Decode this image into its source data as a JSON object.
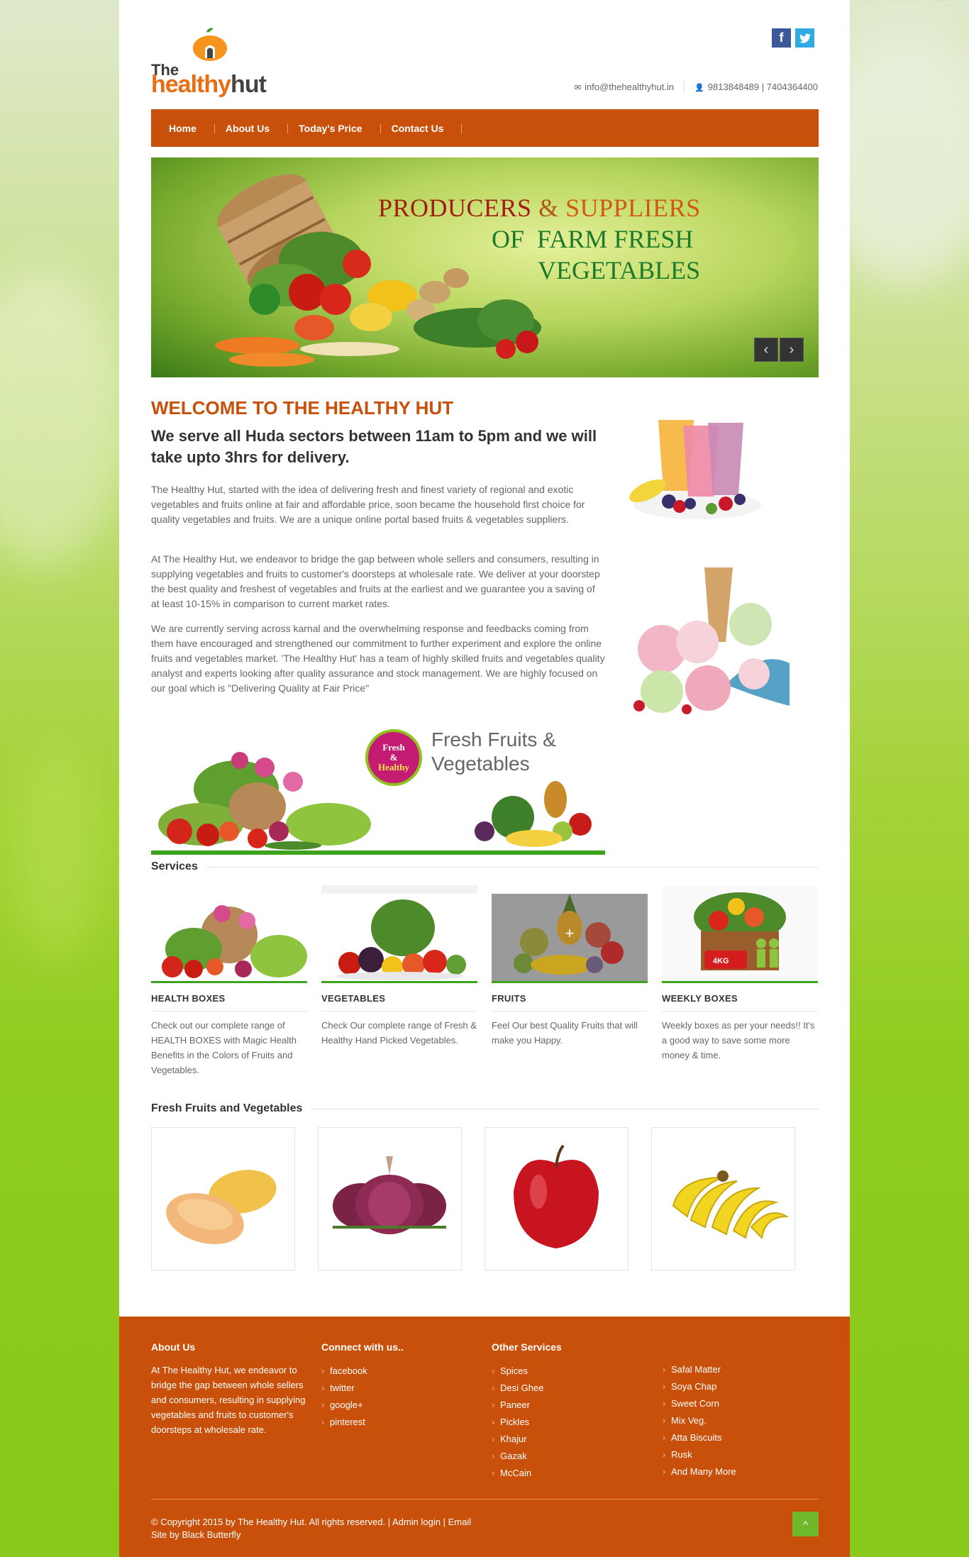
{
  "header": {
    "logo_the": "The",
    "logo_healthy": "healthy",
    "logo_hut": "hut",
    "email": "info@thehealthyhut.in",
    "phone": "9813848489 | 7404364400"
  },
  "social": {
    "facebook": "f",
    "twitter": "t"
  },
  "nav": {
    "items": [
      {
        "label": "Home"
      },
      {
        "label": "About Us"
      },
      {
        "label": "Today's Price"
      },
      {
        "label": "Contact Us"
      }
    ]
  },
  "slider": {
    "line1_a": "PRODUCERS",
    "line1_amp": "&",
    "line1_b": "SUPPLIERS",
    "line2": "OF  FARM FRESH",
    "line3": "VEGETABLES",
    "prev": "‹",
    "next": "›"
  },
  "welcome": {
    "title": "WELCOME TO THE HEALTHY HUT",
    "subtitle": "We serve all Huda sectors between 11am to 5pm and we will take upto 3hrs for delivery.",
    "p1": "The Healthy Hut, started with the idea of delivering fresh and finest variety of regional and exotic vegetables and fruits online at fair and affordable price, soon became the household first choice for quality vegetables and fruits. We are a unique online portal based fruits & vegetables suppliers.",
    "p2": "At The Healthy Hut, we endeavor to bridge the gap between whole sellers and consumers, resulting in supplying vegetables and fruits to customer's doorsteps at wholesale rate. We deliver at your doorstep the best quality and freshest of vegetables and fruits at the earliest and we guarantee you a saving of at least 10-15% in comparison to current market rates.",
    "p3": "We are currently serving across karnal and the overwhelming response and feedbacks coming from them have encouraged and strengthened our commitment to further experiment and explore the online fruits and vegetables market. 'The Healthy Hut' has a team of highly skilled fruits and vegetables quality analyst and experts looking after quality assurance and stock management. We are highly focused on our goal which is \"Delivering Quality at Fair Price\""
  },
  "banner": {
    "badge_l1": "Fresh",
    "badge_l2": "&",
    "badge_l3": "Healthy",
    "line1": "Fresh Fruits &",
    "line2": "Vegetables"
  },
  "services": {
    "heading": "Services",
    "items": [
      {
        "title": "HEALTH BOXES",
        "text": "Check out our complete range of HEALTH BOXES with Magic Health Benefits in the Colors of Fruits and Vegetables."
      },
      {
        "title": "VEGETABLES",
        "text": "Check Our complete range of Fresh & Healthy Hand Picked Vegetables."
      },
      {
        "title": "FRUITS",
        "text": "Feel Our best Quality Fruits that will make you Happy."
      },
      {
        "title": "WEEKLY BOXES",
        "text": "Weekly boxes as per your needs!! It's a good way to save some more money & time."
      }
    ],
    "plus": "+",
    "box_label": "4KG"
  },
  "products": {
    "heading": "Fresh Fruits and Vegetables"
  },
  "footer": {
    "about_title": "About Us",
    "about_text": "At The Healthy Hut, we endeavor to bridge the gap between whole sellers and consumers, resulting in supplying vegetables and fruits to customer's doorsteps at wholesale rate.",
    "connect_title": "Connect with us..",
    "connect": [
      "facebook",
      "twitter",
      "google+",
      "pinterest"
    ],
    "services_title": "Other Services",
    "services_a": [
      "Spices",
      "Desi Ghee",
      "Paneer",
      "Pickles",
      "Khajur",
      "Gazak",
      "McCain"
    ],
    "services_b": [
      "Safal Matter",
      "Soya Chap",
      "Sweet Corn",
      "Mix Veg.",
      "Atta Biscuits",
      "Rusk",
      "And Many More"
    ],
    "copyright": "© Copyright 2015 by The Healthy Hut. All rights reserved. | Admin login | Email",
    "credit": "Site by Black Butterfly",
    "to_top": "^"
  },
  "colors": {
    "accent": "#c9500a",
    "green": "#3da31c",
    "page_bg": "#8fcc1f"
  }
}
